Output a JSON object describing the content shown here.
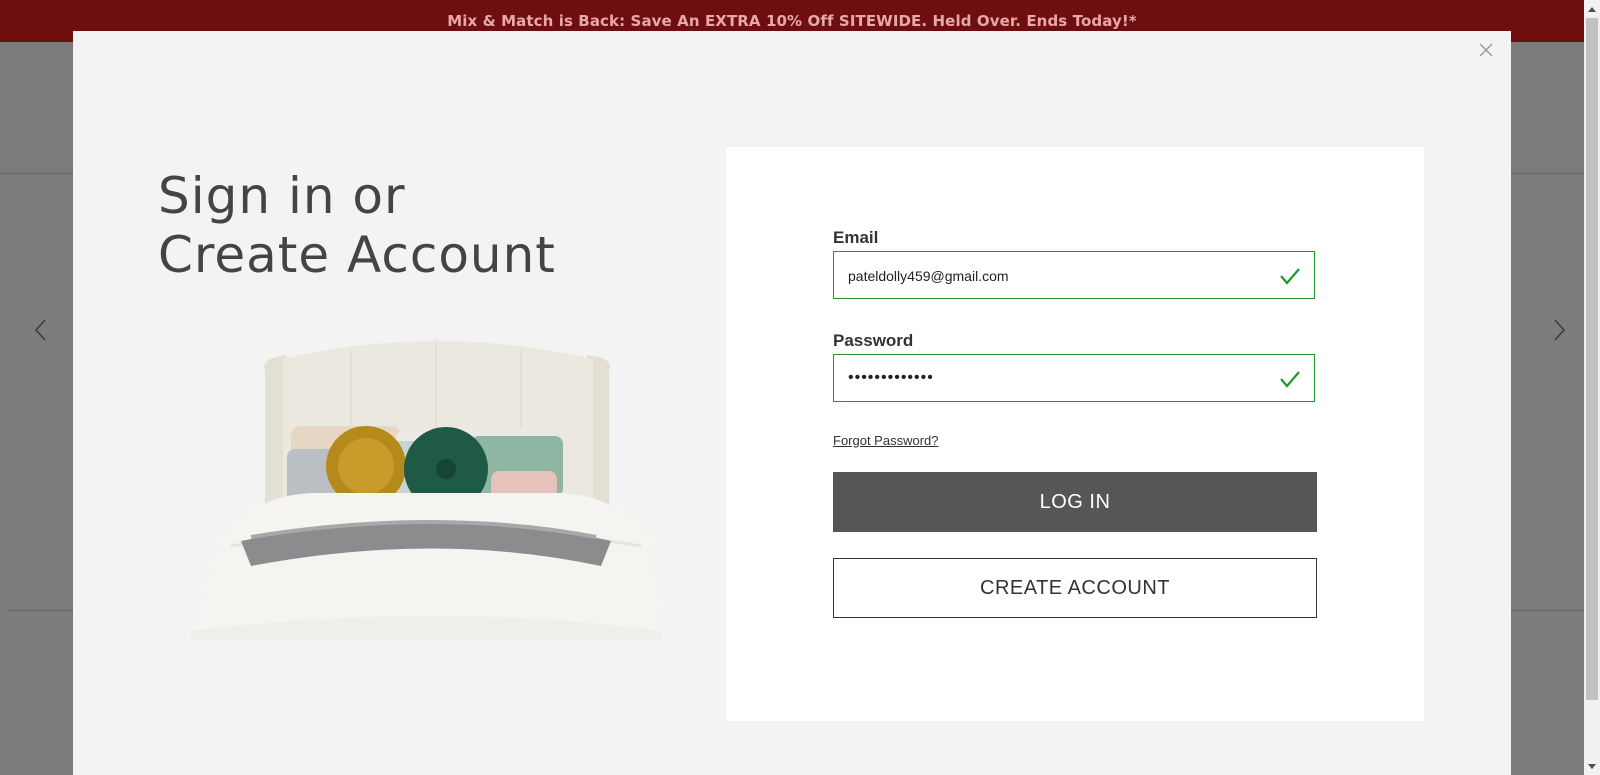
{
  "promo": {
    "text": "Mix & Match is Back: Save An EXTRA 10% Off SITEWIDE. Held Over. Ends Today!*"
  },
  "modal": {
    "heading_line1": "Sign in or",
    "heading_line2": "Create Account",
    "form": {
      "email_label": "Email",
      "email_value": "pateldolly459@gmail.com",
      "password_label": "Password",
      "password_masked": "•••••••••••••",
      "forgot_link": "Forgot Password?",
      "login_button": "LOG IN",
      "create_button": "CREATE ACCOUNT"
    }
  },
  "icons": {
    "close": "close-icon",
    "email_valid": "checkmark-icon",
    "password_valid": "checkmark-icon",
    "carousel_prev": "chevron-left-icon",
    "carousel_next": "chevron-right-icon"
  },
  "colors": {
    "promo_bg": "#6f0e0e",
    "valid_border": "#1e9a2a",
    "login_bg": "#565656",
    "modal_bg": "#f3f3f3"
  }
}
